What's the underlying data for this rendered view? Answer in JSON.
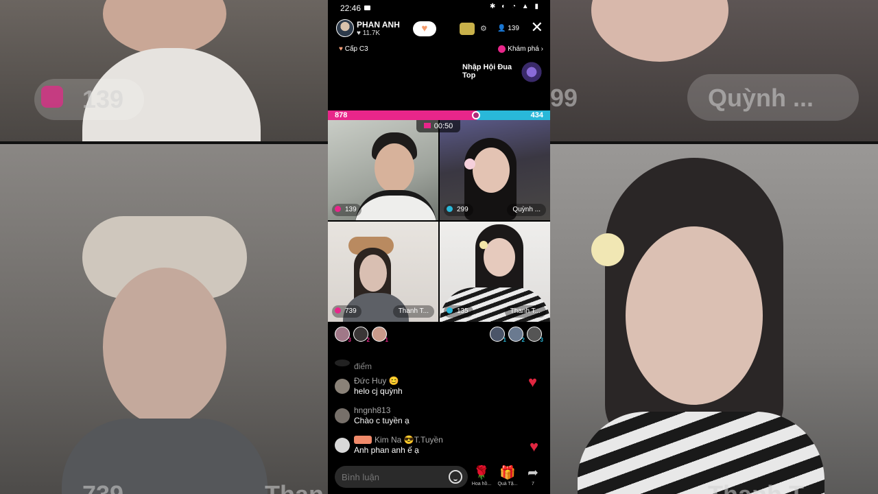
{
  "status_bar": {
    "time": "22:46",
    "icons": "✱ ◐ ◔ ▲ ▮"
  },
  "host": {
    "name": "PHAN ANH",
    "likes": "♥ 11.7K"
  },
  "header": {
    "viewer_count": "139",
    "close_label": "✕"
  },
  "subheader": {
    "level_label": "Cấp C3",
    "explore_label": "Khám phá"
  },
  "promo": {
    "text": "Nhập Hội Đua Top"
  },
  "battle": {
    "left_score": "878",
    "right_score": "434",
    "left_color": "#e8268a",
    "right_color": "#29b8d9"
  },
  "timer": "00:50",
  "participants": [
    {
      "score": "139",
      "name": "",
      "team_color": "#e8268a"
    },
    {
      "score": "299",
      "name": "Quỳnh ...",
      "team_color": "#29b8d9"
    },
    {
      "score": "739",
      "name": "Thanh T...",
      "team_color": "#e8268a"
    },
    {
      "score": "135",
      "name": "Thanh T...",
      "team_color": "#29b8d9"
    }
  ],
  "supporters": {
    "left": [
      {
        "rank": "3"
      },
      {
        "rank": "2"
      },
      {
        "rank": "1"
      }
    ],
    "right": [
      {
        "rank": "1"
      },
      {
        "rank": "2"
      },
      {
        "rank": "3"
      }
    ]
  },
  "comments": [
    {
      "name": "",
      "text": "điểm"
    },
    {
      "name": "Đức Huy 😊",
      "text": "helo cj quỳnh"
    },
    {
      "name": "hngnh813",
      "text": "Chào c tuyền ạ"
    },
    {
      "name": "Kim Na 😎T.Tuyền",
      "text": "Anh phan anh ế ạ"
    }
  ],
  "bottom_bar": {
    "comment_placeholder": "Bình luận",
    "actions": [
      {
        "icon": "🌹",
        "label": "Hoa hồ..."
      },
      {
        "icon": "🎁",
        "label": "Quà Tặ..."
      },
      {
        "icon": "➦",
        "label": "7"
      }
    ]
  },
  "background_overlay": {
    "left_top_score": "139",
    "right_top_name": "Quỳnh ...",
    "right_top_score": "99",
    "bottom_left_score": "739",
    "bottom_left_name": "Than",
    "bottom_right_name": "Thanh T"
  }
}
